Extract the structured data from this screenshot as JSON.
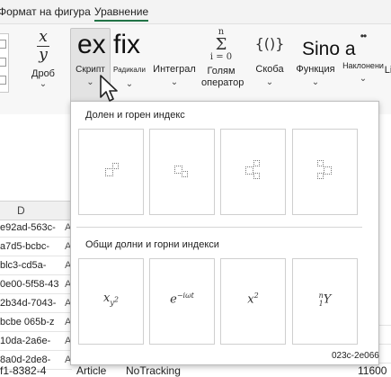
{
  "tabs": {
    "shape_format": "Формат на фигура",
    "equation": "Уравнение"
  },
  "ribbon": {
    "fraction": {
      "top": "x",
      "bottom": "y",
      "label": "Дроб"
    },
    "script": {
      "big": "ex fix",
      "label": "Скрипт"
    },
    "radical": {
      "label": "Радикали"
    },
    "integral": {
      "label": "Интеграл"
    },
    "large_operator": {
      "top": "n",
      "symbol": "Σ",
      "bottom": "i = 0",
      "label1": "Голям",
      "label2": "оператор"
    },
    "bracket": {
      "symbol": "{()}",
      "label": "Скоба"
    },
    "function": {
      "big": "Sino a",
      "label": "Функция"
    },
    "accent": {
      "label": "Наклонени"
    },
    "limit": {
      "label": "Li"
    }
  },
  "sheet": {
    "column_label": "D",
    "rows": [
      {
        "text": "e92ad-563c-",
        "mark": "A"
      },
      {
        "text": "a7d5-bcbc-",
        "mark": "A"
      },
      {
        "text": "blc3-cd5a-",
        "mark": "A"
      },
      {
        "text": "0e00-5f58-43",
        "mark": "A"
      },
      {
        "text": "2b34d-7043-",
        "mark": "A"
      },
      {
        "text": "bcbe 065b-z",
        "mark": "A"
      },
      {
        "text": "10da-2a6e-",
        "mark": "A"
      },
      {
        "text": "8a0d-2de8-",
        "mark": "A"
      }
    ],
    "bottom_left": "f1-8382-4",
    "bottom_article": "Article",
    "bottom_tracking": "NoTracking",
    "bottom_right": "11600"
  },
  "gallery": {
    "section1_title": "Долен и горен индекс",
    "section2_title": "Общи долни и горни индекси",
    "f1_base": "x",
    "f1_sub": "y",
    "f1_subsup": "2",
    "f2_base": "e",
    "f2_sup": "−iωt",
    "f3_base": "x",
    "f3_sup": "2",
    "f4_pre_sup": "n",
    "f4_pre_sub": "1",
    "f4_base": "Y",
    "footer_text": "023c-2e066"
  }
}
